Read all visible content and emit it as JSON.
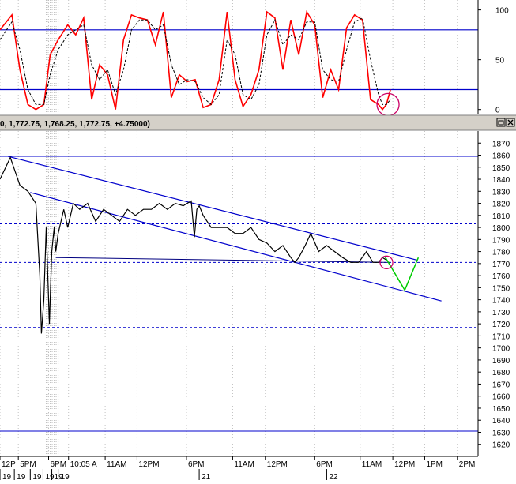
{
  "window": {
    "header_text": "0, 1,772.75, 1,768.25, 1,772.75, +4.75000)",
    "header_buttons": [
      "restore-icon",
      "close-icon"
    ]
  },
  "colors": {
    "background": "#ffffff",
    "chart_bg": "#ffffff",
    "grid": "#c0c0c0",
    "price": "#000000",
    "oscillator_k": "#ff0000",
    "oscillator_d": "#000000",
    "channel": "#0000cc",
    "level": "#0000cc",
    "projection": "#00cc00",
    "highlight": "#cc0066",
    "header_bg": "#d4d0c8"
  },
  "chart_data": [
    {
      "type": "line",
      "panel": "oscillator",
      "title": "",
      "ylabel": "",
      "ylim": [
        -5,
        110
      ],
      "yticks": [
        "100",
        "50",
        "0"
      ],
      "ytick_values": [
        100,
        50,
        0
      ],
      "hlines": [
        80,
        20
      ],
      "highlight_circle": {
        "x": 48.7,
        "y": 5
      },
      "series": [
        {
          "style": "solid",
          "x": [
            0,
            1.5,
            2.5,
            3.5,
            4.5,
            5.5,
            6.3,
            7.3,
            8.5,
            9.5,
            10.5,
            11.5,
            12.5,
            13.5,
            14.5,
            15.5,
            16.5,
            17.5,
            18.5,
            19.5,
            20.5,
            21.5,
            22.5,
            23.5,
            24.5,
            25.5,
            26.5,
            27.5,
            28.5,
            29.5,
            30.5,
            31.5,
            32.5,
            33.5,
            34.5,
            35.5,
            36.5,
            37.5,
            38.5,
            39.5,
            40.5,
            41.5,
            42.5,
            43.5,
            44.5,
            45.5,
            46.5,
            47.5,
            48,
            48.5,
            49
          ],
          "y": [
            80,
            95,
            40,
            5,
            0,
            5,
            55,
            70,
            85,
            75,
            92,
            10,
            45,
            35,
            0,
            70,
            95,
            92,
            90,
            65,
            98,
            12,
            35,
            28,
            30,
            2,
            5,
            30,
            98,
            30,
            3,
            15,
            40,
            98,
            92,
            40,
            90,
            55,
            98,
            85,
            12,
            40,
            20,
            82,
            95,
            90,
            10,
            5,
            0,
            5,
            20
          ]
        },
        {
          "style": "dashed",
          "x": [
            0,
            1.5,
            2.5,
            3.5,
            4.5,
            5.5,
            6.3,
            7.3,
            8.5,
            9.5,
            10.5,
            11.5,
            12.5,
            13.5,
            14.5,
            15.5,
            16.5,
            17.5,
            18.5,
            19.5,
            20.5,
            21.5,
            22.5,
            23.5,
            24.5,
            25.5,
            26.5,
            27.5,
            28.5,
            29.5,
            30.5,
            31.5,
            32.5,
            33.5,
            34.5,
            35.5,
            36.5,
            37.5,
            38.5,
            39.5,
            40.5,
            41.5,
            42.5,
            43.5,
            44.5,
            45.5,
            46.5,
            47.5,
            48,
            48.5,
            49
          ],
          "y": [
            70,
            88,
            60,
            20,
            5,
            5,
            35,
            60,
            75,
            80,
            85,
            45,
            30,
            40,
            15,
            40,
            80,
            90,
            90,
            80,
            85,
            45,
            25,
            30,
            28,
            12,
            5,
            15,
            70,
            55,
            15,
            10,
            25,
            75,
            90,
            65,
            75,
            70,
            88,
            88,
            40,
            30,
            28,
            60,
            88,
            92,
            50,
            15,
            5,
            5,
            10
          ]
        }
      ]
    },
    {
      "type": "line",
      "panel": "price",
      "title": "",
      "ylabel": "",
      "ylim": [
        1610,
        1880
      ],
      "yticks": [
        "1870",
        "1860",
        "1850",
        "1840",
        "1830",
        "1820",
        "1810",
        "1800",
        "1790",
        "1780",
        "1770",
        "1760",
        "1750",
        "1740",
        "1730",
        "1720",
        "1710",
        "1700",
        "1690",
        "1680",
        "1670",
        "1660",
        "1650",
        "1640",
        "1630",
        "1620"
      ],
      "ytick_values": [
        1870,
        1860,
        1850,
        1840,
        1830,
        1820,
        1810,
        1800,
        1790,
        1780,
        1770,
        1760,
        1750,
        1740,
        1730,
        1720,
        1710,
        1700,
        1690,
        1680,
        1670,
        1660,
        1650,
        1640,
        1630,
        1620
      ],
      "xlim": [
        0,
        60
      ],
      "xticks": [
        "12P",
        "5PM",
        "6PM",
        "10:05 A",
        "11AM",
        "12PM",
        "6PM",
        "11AM",
        "12PM",
        "6PM",
        "11AM",
        "12PM",
        "1PM",
        "2PM"
      ],
      "xtick_values": [
        0,
        2.3,
        6.1,
        8.6,
        13.2,
        17.2,
        23.4,
        29.2,
        33.3,
        39.5,
        45.2,
        49.3,
        53.3,
        57.4
      ],
      "date_labels": [
        "19",
        "19",
        "19",
        "19",
        "19",
        "19",
        "21",
        "22"
      ],
      "date_label_values": [
        0,
        1.8,
        3.8,
        5.4,
        6.5,
        7.3,
        25,
        41
      ],
      "hlines": [
        {
          "y": 1859,
          "style": "solid"
        },
        {
          "y": 1803,
          "style": "dashed"
        },
        {
          "y": 1771,
          "style": "dashed"
        },
        {
          "y": 1744,
          "style": "dashed"
        },
        {
          "y": 1717,
          "style": "dashed"
        },
        {
          "y": 1631,
          "style": "solid"
        }
      ],
      "trendlines": [
        {
          "x": [
            1,
            52.3
          ],
          "y": [
            1859,
            1773
          ]
        },
        {
          "x": [
            3.8,
            55.4
          ],
          "y": [
            1829,
            1739
          ]
        }
      ],
      "flat_line": {
        "x": [
          7,
          49
        ],
        "y": [
          1775,
          1771
        ]
      },
      "projection": {
        "x": [
          48.3,
          50.8,
          52.5
        ],
        "y": [
          1776,
          1748,
          1775
        ]
      },
      "highlight_circle": {
        "x": 48.5,
        "y": 1771
      },
      "series": [
        {
          "name": "",
          "x": [
            0,
            1.3,
            2.5,
            3.5,
            4.5,
            5.0,
            5.2,
            5.5,
            5.8,
            6.2,
            6.5,
            6.8,
            7.0,
            7.3,
            8.0,
            8.5,
            9.2,
            10.0,
            11.0,
            12.0,
            13.0,
            14.0,
            15.0,
            16.0,
            17.0,
            18.0,
            19.0,
            20.0,
            21.0,
            22.0,
            23.0,
            24.0,
            24.4,
            24.7,
            25.0,
            25.5,
            26.5,
            27.5,
            28.5,
            29.5,
            30.5,
            31.5,
            32.5,
            33.5,
            34.5,
            35.5,
            36.5,
            37.0,
            37.5,
            38.3,
            39.0,
            40.0,
            41.0,
            42.0,
            43.0,
            44.0,
            45.0,
            46.0,
            46.8,
            47.5,
            48.0,
            48.5
          ],
          "y": [
            1840,
            1858,
            1835,
            1830,
            1820,
            1760,
            1712,
            1740,
            1800,
            1720,
            1780,
            1800,
            1780,
            1795,
            1815,
            1800,
            1820,
            1815,
            1820,
            1805,
            1815,
            1810,
            1805,
            1815,
            1810,
            1815,
            1815,
            1820,
            1815,
            1820,
            1818,
            1822,
            1792,
            1815,
            1818,
            1810,
            1800,
            1800,
            1800,
            1795,
            1795,
            1800,
            1790,
            1787,
            1780,
            1785,
            1775,
            1771,
            1775,
            1785,
            1795,
            1780,
            1785,
            1780,
            1775,
            1771,
            1771,
            1780,
            1771,
            1771,
            1775,
            1773
          ]
        }
      ]
    }
  ]
}
